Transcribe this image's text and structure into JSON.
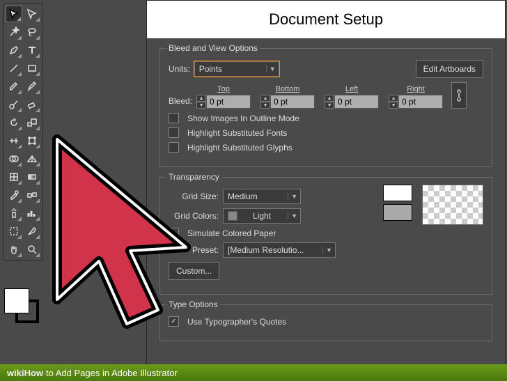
{
  "dialog": {
    "title": "Document Setup"
  },
  "group_bleed": {
    "title": "Bleed and View Options",
    "units_label": "Units:",
    "units_value": "Points",
    "edit_artboards": "Edit Artboards",
    "bleed_label": "Bleed:",
    "top": "Top",
    "bottom": "Bottom",
    "left": "Left",
    "right": "Right",
    "bleed_value": "0 pt",
    "show_images": "Show Images In Outline Mode",
    "hl_fonts": "Highlight Substituted Fonts",
    "hl_glyphs": "Highlight Substituted Glyphs"
  },
  "group_trans": {
    "title": "Transparency",
    "grid_size_label": "Grid Size:",
    "grid_size_value": "Medium",
    "grid_colors_label": "Grid Colors:",
    "grid_colors_value": "Light",
    "simulate": "Simulate Colored Paper",
    "preset_label": "Preset:",
    "preset_value": "[Medium Resolutio...",
    "custom": "Custom..."
  },
  "group_type": {
    "title": "Type Options",
    "typographers": "Use Typographer's Quotes"
  },
  "footer": {
    "brand": "wikiHow",
    "text": " to Add Pages in Adobe Illustrator"
  },
  "tools": [
    [
      "selection",
      "direct-selection"
    ],
    [
      "magic-wand",
      "lasso"
    ],
    [
      "pen",
      "type"
    ],
    [
      "line-segment",
      "rectangle"
    ],
    [
      "paintbrush",
      "pencil"
    ],
    [
      "blob-brush",
      "eraser"
    ],
    [
      "rotate",
      "scale"
    ],
    [
      "width",
      "free-transform"
    ],
    [
      "shape-builder",
      "perspective-grid"
    ],
    [
      "mesh",
      "gradient"
    ],
    [
      "eyedropper",
      "blend"
    ],
    [
      "symbol-sprayer",
      "column-graph"
    ],
    [
      "artboard",
      "slice"
    ],
    [
      "hand",
      "zoom"
    ]
  ]
}
